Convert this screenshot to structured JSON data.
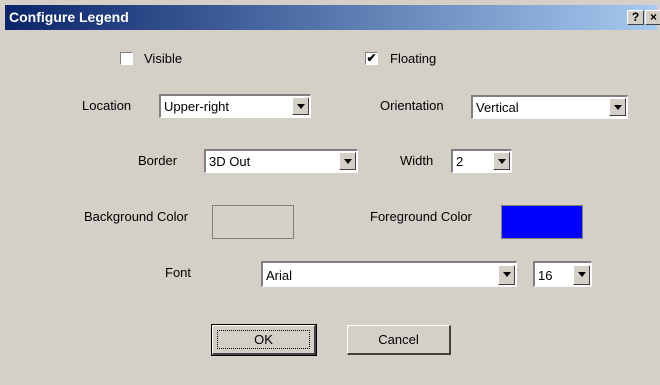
{
  "window": {
    "title": "Configure Legend",
    "help_glyph": "?",
    "close_glyph": "×"
  },
  "visible": {
    "label": "Visible",
    "checked": false
  },
  "floating": {
    "label": "Floating",
    "checked": true
  },
  "location": {
    "label": "Location",
    "value": "Upper-right"
  },
  "orientation": {
    "label": "Orientation",
    "value": "Vertical"
  },
  "border": {
    "label": "Border",
    "value": "3D Out"
  },
  "width": {
    "label": "Width",
    "value": "2"
  },
  "background_color": {
    "label": "Background Color",
    "color": "#d4d0c8"
  },
  "foreground_color": {
    "label": "Foreground Color",
    "color": "#0000ff"
  },
  "font": {
    "label": "Font",
    "value": "Arial",
    "size": "16"
  },
  "buttons": {
    "ok": "OK",
    "cancel": "Cancel"
  },
  "checkmark": "✔"
}
